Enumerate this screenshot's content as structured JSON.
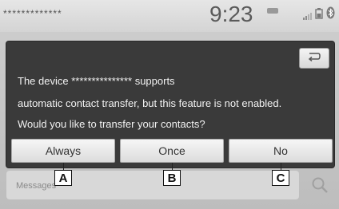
{
  "status_bar": {
    "device_name_masked": "*************",
    "time": "9:23"
  },
  "dialog": {
    "line1": "The device *************** supports",
    "line2": "automatic contact transfer, but this feature is not enabled.",
    "line3": "Would you like to transfer your contacts?",
    "buttons": {
      "always": "Always",
      "once": "Once",
      "no": "No"
    }
  },
  "background": {
    "search_label": "Messages"
  },
  "callouts": {
    "a": "A",
    "b": "B",
    "c": "C"
  },
  "icons": {
    "back": "return-arrow-icon",
    "signal": "signal-icon",
    "battery": "battery-icon",
    "bluetooth": "bluetooth-icon",
    "search": "search-icon"
  },
  "colors": {
    "dialog_bg": "#3a3a3a",
    "button_bg": "#e8e8e8",
    "text_light": "#f2f2f2"
  }
}
